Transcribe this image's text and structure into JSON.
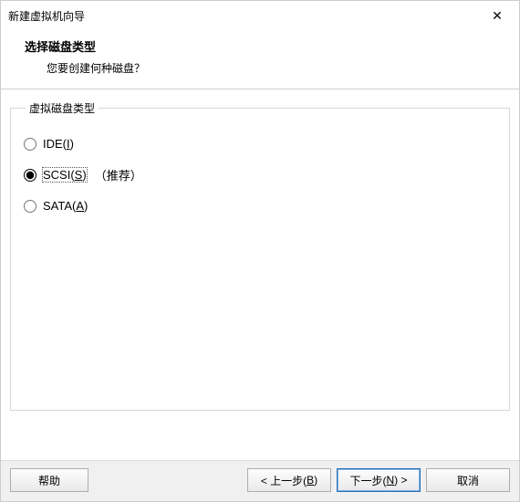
{
  "titlebar": {
    "title": "新建虚拟机向导",
    "close": "✕"
  },
  "header": {
    "heading": "选择磁盘类型",
    "subheading": "您要创建何种磁盘？"
  },
  "group": {
    "legend": "虚拟磁盘类型",
    "options": [
      {
        "prefix": "IDE(",
        "accel": "I",
        "suffix": ")",
        "hint": "",
        "selected": false
      },
      {
        "prefix": "SCSI(",
        "accel": "S",
        "suffix": ")",
        "hint": "（推荐）",
        "selected": true
      },
      {
        "prefix": "SATA(",
        "accel": "A",
        "suffix": ")",
        "hint": "",
        "selected": false
      }
    ]
  },
  "footer": {
    "help": "帮助",
    "back_prefix": "< 上一步(",
    "back_accel": "B",
    "back_suffix": ")",
    "next_prefix": "下一步(",
    "next_accel": "N",
    "next_suffix": ") >",
    "cancel": "取消"
  }
}
